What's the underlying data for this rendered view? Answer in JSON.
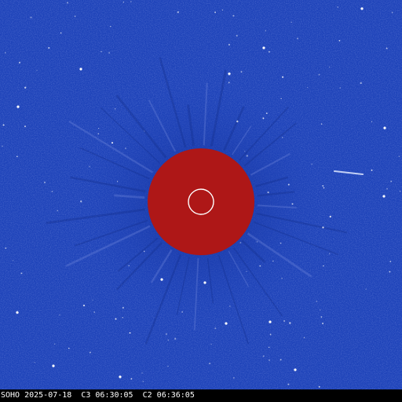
{
  "image": {
    "background_color": "#1e43b9",
    "occulter_color": "#b41818",
    "sun_outline_color": "#ffffff",
    "streak_color": "#dfe8ff",
    "star_color": "#ffffff"
  },
  "caption": {
    "text": "SOHO 2025-07-18  C3 06:30:05  C2 06:36:05"
  }
}
